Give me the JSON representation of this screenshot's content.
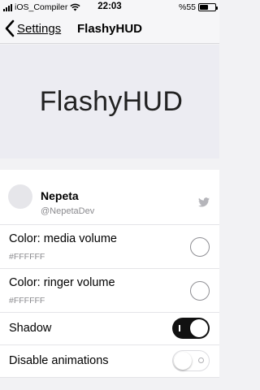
{
  "status_bar": {
    "carrier": "iOS_Compiler",
    "time": "22:03",
    "battery_text": "%55",
    "battery_level": 0.55
  },
  "nav": {
    "back_label": "Settings",
    "title": "FlashyHUD"
  },
  "banner": {
    "title": "FlashyHUD"
  },
  "developer": {
    "name": "Nepeta",
    "handle": "@NepetaDev",
    "icon": "twitter-icon"
  },
  "settings": {
    "media_volume": {
      "label": "Color: media volume",
      "value": "#FFFFFF"
    },
    "ringer_volume": {
      "label": "Color: ringer volume",
      "value": "#FFFFFF"
    },
    "shadow": {
      "label": "Shadow",
      "enabled": true
    },
    "disable_animations": {
      "label": "Disable animations",
      "enabled": false
    }
  },
  "colors": {
    "toggle_on": "#111111",
    "background": "#f2f2f4"
  }
}
